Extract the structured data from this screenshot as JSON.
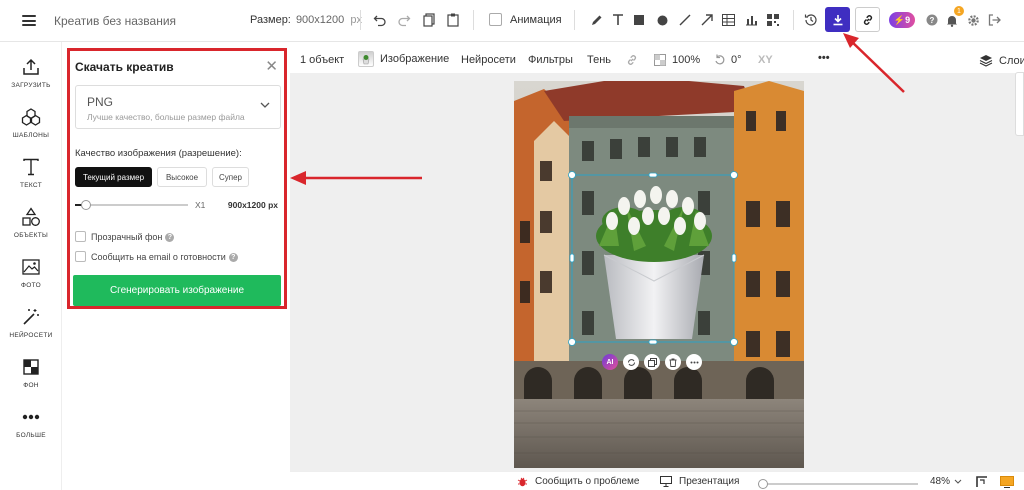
{
  "topbar": {
    "title": "Креатив без названия",
    "size_label": "Размер:",
    "size_value": "900x1200",
    "size_unit": "px",
    "animation_label": "Анимация",
    "pro_badge": "9",
    "notification_count": "1"
  },
  "sidebar": {
    "items": [
      {
        "label": "ЗАГРУЗИТЬ",
        "icon": "upload-icon"
      },
      {
        "label": "ШАБЛОНЫ",
        "icon": "templates-icon"
      },
      {
        "label": "ТЕКСТ",
        "icon": "text-icon"
      },
      {
        "label": "ОБЪЕКТЫ",
        "icon": "shapes-icon"
      },
      {
        "label": "ФОТО",
        "icon": "photo-icon"
      },
      {
        "label": "НЕЙРОСЕТИ",
        "icon": "magic-wand-icon"
      },
      {
        "label": "ФОН",
        "icon": "background-icon"
      },
      {
        "label": "БОЛЬШЕ",
        "icon": "more-dots-icon"
      }
    ]
  },
  "download_panel": {
    "title": "Скачать креатив",
    "format": "PNG",
    "format_desc": "Лучше качество, больше размер файла",
    "quality_label": "Качество изображения (разрешение):",
    "quality_options": [
      "Текущий размер",
      "Высокое",
      "Супер"
    ],
    "selected_quality": "Текущий размер",
    "slider_multiplier": "X1",
    "slider_level": 0.1,
    "resolution": "900x1200 px",
    "transparent_bg": "Прозрачный фон",
    "email_notify": "Сообщить на email о готовности",
    "generate_button": "Сгенерировать изображение"
  },
  "object_toolbar": {
    "count": "1 объект",
    "image": "Изображение",
    "neural": "Нейросети",
    "filters": "Фильтры",
    "shadow": "Тень",
    "opacity": "100%",
    "rotation": "0°",
    "xy": "XY",
    "more": "•••",
    "layers": "Слои"
  },
  "selection_actions": {
    "ai": "AI"
  },
  "bottombar": {
    "report": "Сообщить о проблеме",
    "presentation": "Презентация",
    "zoom": "48%",
    "zoom_level": 0.48
  },
  "colors": {
    "accent": "#3f2ec1",
    "highlight": "#d9262c",
    "generate": "#1fba5c",
    "selection": "#2aa3c7"
  }
}
